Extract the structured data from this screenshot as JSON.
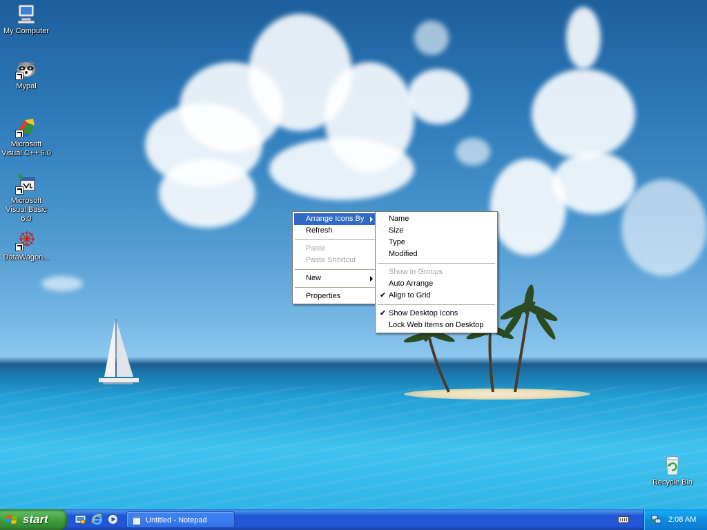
{
  "desktop": {
    "icons": [
      {
        "label": "My Computer",
        "icon": "my-computer-icon"
      },
      {
        "label": "Mypal",
        "icon": "raccoon-icon"
      },
      {
        "label": "Microsoft Visual C++ 6.0",
        "icon": "visual-cpp-icon"
      },
      {
        "label": "Microsoft Visual Basic 6.0",
        "icon": "visual-basic-icon"
      },
      {
        "label": "DataWagon...",
        "icon": "datawagon-icon"
      },
      {
        "label": "Recycle Bin",
        "icon": "recycle-bin-icon"
      }
    ]
  },
  "context_menu": {
    "items": [
      {
        "label": "Arrange Icons By",
        "state": "highlighted",
        "submenu": true
      },
      {
        "label": "Refresh"
      },
      {
        "label": "Paste",
        "state": "disabled"
      },
      {
        "label": "Paste Shortcut",
        "state": "disabled"
      },
      {
        "label": "New",
        "submenu": true
      },
      {
        "label": "Properties"
      }
    ]
  },
  "submenu": {
    "items": [
      {
        "label": "Name"
      },
      {
        "label": "Size"
      },
      {
        "label": "Type"
      },
      {
        "label": "Modified"
      },
      {
        "label": "Show in Groups",
        "state": "disabled"
      },
      {
        "label": "Auto Arrange"
      },
      {
        "label": "Align to Grid",
        "checked": true
      },
      {
        "label": "Show Desktop Icons",
        "checked": true
      },
      {
        "label": "Lock Web Items on Desktop"
      }
    ],
    "check_glyph": "✔"
  },
  "taskbar": {
    "start_label": "start",
    "quick_launch": [
      "show-desktop-icon",
      "internet-explorer-icon",
      "media-player-icon"
    ],
    "tasks": [
      {
        "label": "Untitled - Notepad",
        "icon": "notepad-icon"
      }
    ],
    "tray": {
      "clock": "2:08 AM",
      "icons": [
        "keyboard-icon",
        "network-icon"
      ]
    }
  },
  "colors": {
    "menu_highlight": "#316ac5",
    "taskbar_blue": "#2157d7",
    "start_green": "#3d9d3d",
    "tray_blue": "#0f8be0"
  }
}
